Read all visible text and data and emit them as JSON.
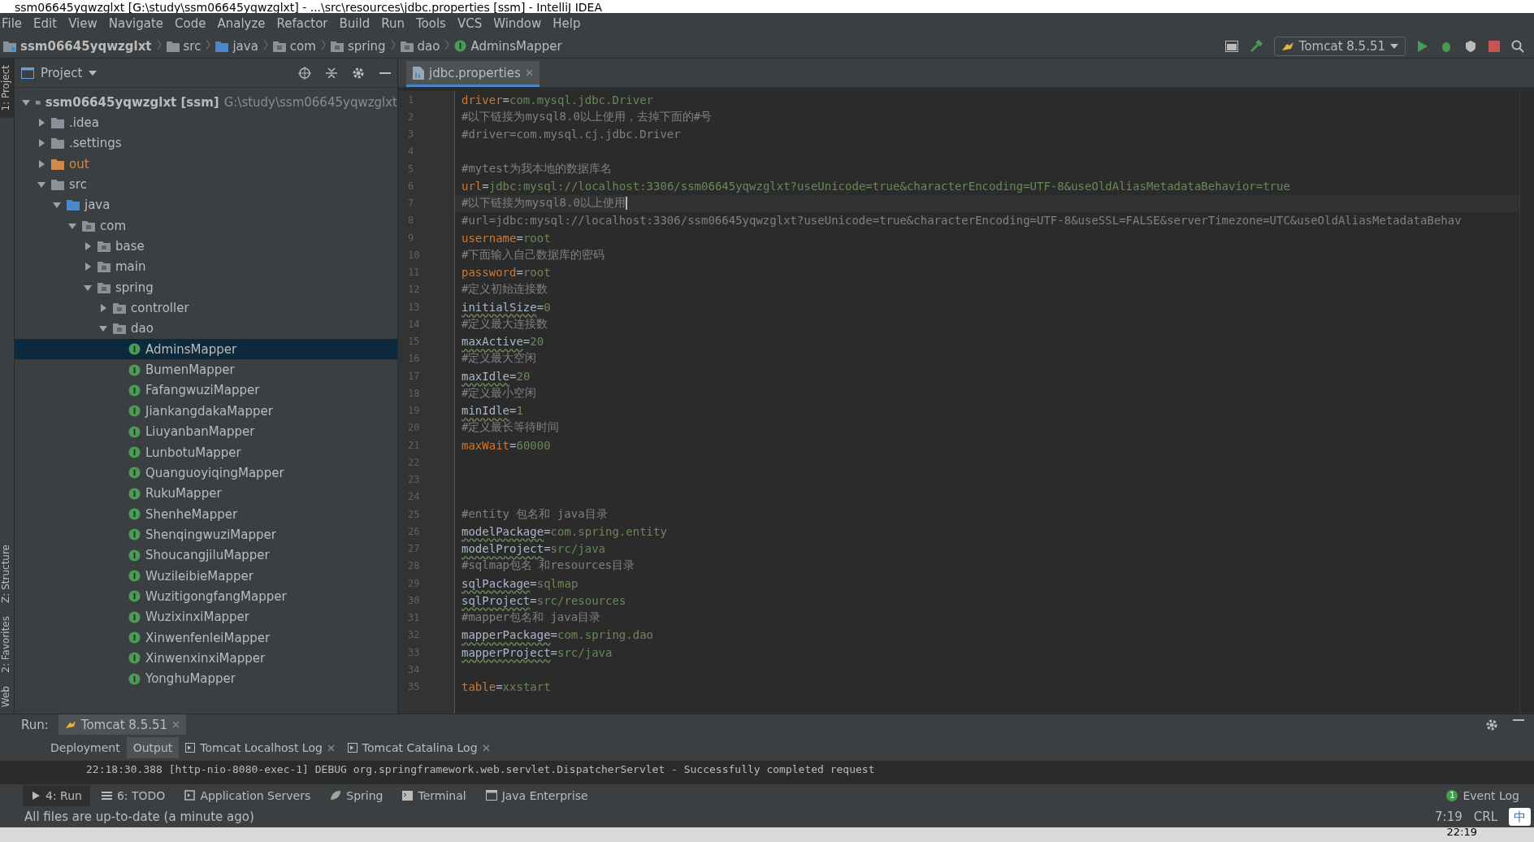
{
  "window": {
    "title": "ssm06645yqwzglxt [G:\\study\\ssm06645yqwzglxt] - ...\\src\\resources\\jdbc.properties [ssm] - IntelliJ IDEA"
  },
  "menu": [
    "File",
    "Edit",
    "View",
    "Navigate",
    "Code",
    "Analyze",
    "Refactor",
    "Build",
    "Run",
    "Tools",
    "VCS",
    "Window",
    "Help"
  ],
  "breadcrumbs": [
    {
      "label": "ssm06645yqwzglxt",
      "kind": "module"
    },
    {
      "label": "src",
      "kind": "folder"
    },
    {
      "label": "java",
      "kind": "source"
    },
    {
      "label": "com",
      "kind": "package"
    },
    {
      "label": "spring",
      "kind": "package"
    },
    {
      "label": "dao",
      "kind": "package"
    },
    {
      "label": "AdminsMapper",
      "kind": "interface"
    }
  ],
  "run_config": {
    "label": "Tomcat 8.5.51"
  },
  "side_tabs": [
    {
      "label": "1: Project",
      "selected": true
    },
    {
      "label": "Z: Structure",
      "selected": false
    },
    {
      "label": "2: Favorites",
      "selected": false
    },
    {
      "label": "Web",
      "selected": false
    }
  ],
  "project_panel": {
    "title": "Project",
    "tree": [
      {
        "label": "ssm06645yqwzglxt [ssm]",
        "path": "G:\\study\\ssm06645yqwzglxt",
        "kind": "module",
        "expanded": true,
        "selected": false,
        "children": [
          {
            "label": ".idea",
            "kind": "folder",
            "expanded": false,
            "selected": false
          },
          {
            "label": ".settings",
            "kind": "folder",
            "expanded": false,
            "selected": false
          },
          {
            "label": "out",
            "kind": "excluded",
            "expanded": false,
            "selected": false
          },
          {
            "label": "src",
            "kind": "folder",
            "expanded": true,
            "selected": false,
            "children": [
              {
                "label": "java",
                "kind": "source",
                "expanded": true,
                "selected": false,
                "children": [
                  {
                    "label": "com",
                    "kind": "package",
                    "expanded": true,
                    "selected": false,
                    "children": [
                      {
                        "label": "base",
                        "kind": "package",
                        "expanded": false,
                        "selected": false
                      },
                      {
                        "label": "main",
                        "kind": "package",
                        "expanded": false,
                        "selected": false
                      },
                      {
                        "label": "spring",
                        "kind": "package",
                        "expanded": true,
                        "selected": false,
                        "children": [
                          {
                            "label": "controller",
                            "kind": "package",
                            "expanded": false,
                            "selected": false
                          },
                          {
                            "label": "dao",
                            "kind": "package",
                            "expanded": true,
                            "selected": false,
                            "children": [
                              {
                                "label": "AdminsMapper",
                                "kind": "interface",
                                "selected": true
                              },
                              {
                                "label": "BumenMapper",
                                "kind": "interface",
                                "selected": false
                              },
                              {
                                "label": "FafangwuziMapper",
                                "kind": "interface",
                                "selected": false
                              },
                              {
                                "label": "JiankangdakaMapper",
                                "kind": "interface",
                                "selected": false
                              },
                              {
                                "label": "LiuyanbanMapper",
                                "kind": "interface",
                                "selected": false
                              },
                              {
                                "label": "LunbotuMapper",
                                "kind": "interface",
                                "selected": false
                              },
                              {
                                "label": "QuanguoyiqingMapper",
                                "kind": "interface",
                                "selected": false
                              },
                              {
                                "label": "RukuMapper",
                                "kind": "interface",
                                "selected": false
                              },
                              {
                                "label": "ShenheMapper",
                                "kind": "interface",
                                "selected": false
                              },
                              {
                                "label": "ShenqingwuziMapper",
                                "kind": "interface",
                                "selected": false
                              },
                              {
                                "label": "ShoucangjiluMapper",
                                "kind": "interface",
                                "selected": false
                              },
                              {
                                "label": "WuzileibieMapper",
                                "kind": "interface",
                                "selected": false
                              },
                              {
                                "label": "WuzitigongfangMapper",
                                "kind": "interface",
                                "selected": false
                              },
                              {
                                "label": "WuzixinxiMapper",
                                "kind": "interface",
                                "selected": false
                              },
                              {
                                "label": "XinwenfenleiMapper",
                                "kind": "interface",
                                "selected": false
                              },
                              {
                                "label": "XinwenxinxiMapper",
                                "kind": "interface",
                                "selected": false
                              },
                              {
                                "label": "YonghuMapper",
                                "kind": "interface",
                                "selected": false
                              }
                            ]
                          }
                        ]
                      }
                    ]
                  }
                ]
              }
            ]
          }
        ]
      }
    ]
  },
  "editor": {
    "tabs": [
      {
        "label": "jdbc.properties",
        "selected": true
      }
    ],
    "lines": [
      {
        "number": "1",
        "kind": "prop",
        "key": "driver",
        "separator": "=",
        "value": "com.mysql.jdbc.Driver",
        "unresolved": false,
        "current": false
      },
      {
        "number": "2",
        "kind": "comment",
        "text": "#以下链接为mysql8.0以上使用，去掉下面的#号",
        "current": false
      },
      {
        "number": "3",
        "kind": "comment",
        "text": "#driver=com.mysql.cj.jdbc.Driver",
        "current": false
      },
      {
        "number": "4",
        "kind": "blank",
        "current": false
      },
      {
        "number": "5",
        "kind": "comment",
        "text": "#mytest为我本地的数据库名",
        "current": false
      },
      {
        "number": "6",
        "kind": "prop",
        "key": "url",
        "separator": "=",
        "value": "jdbc:mysql://localhost:3306/ssm06645yqwzglxt?useUnicode=true&characterEncoding=UTF-8&useOldAliasMetadataBehavior=true",
        "unresolved": false,
        "current": false
      },
      {
        "number": "7",
        "kind": "comment",
        "text": "#以下链接为mysql8.0以上使用",
        "current": true
      },
      {
        "number": "8",
        "kind": "comment",
        "text": "#url=jdbc:mysql://localhost:3306/ssm06645yqwzglxt?useUnicode=true&characterEncoding=UTF-8&useSSL=FALSE&serverTimezone=UTC&useOldAliasMetadataBehav",
        "current": false
      },
      {
        "number": "9",
        "kind": "prop",
        "key": "username",
        "separator": "=",
        "value": "root",
        "unresolved": false,
        "current": false
      },
      {
        "number": "10",
        "kind": "comment",
        "text": "#下面输入自己数据库的密码",
        "current": false
      },
      {
        "number": "11",
        "kind": "prop",
        "key": "password",
        "separator": "=",
        "value": "root",
        "unresolved": false,
        "current": false
      },
      {
        "number": "12",
        "kind": "comment",
        "text": "#定义初始连接数",
        "current": false
      },
      {
        "number": "13",
        "kind": "prop",
        "key": "initialSize",
        "separator": "=",
        "value": "0",
        "unresolved": true,
        "current": false
      },
      {
        "number": "14",
        "kind": "comment",
        "text": "#定义最大连接数",
        "current": false
      },
      {
        "number": "15",
        "kind": "prop",
        "key": "maxActive",
        "separator": "=",
        "value": "20",
        "unresolved": true,
        "current": false
      },
      {
        "number": "16",
        "kind": "comment",
        "text": "#定义最大空闲",
        "current": false
      },
      {
        "number": "17",
        "kind": "prop",
        "key": "maxIdle",
        "separator": "=",
        "value": "20",
        "unresolved": true,
        "current": false
      },
      {
        "number": "18",
        "kind": "comment",
        "text": "#定义最小空闲",
        "current": false
      },
      {
        "number": "19",
        "kind": "prop",
        "key": "minIdle",
        "separator": "=",
        "value": "1",
        "unresolved": true,
        "current": false
      },
      {
        "number": "20",
        "kind": "comment",
        "text": "#定义最长等待时间",
        "current": false
      },
      {
        "number": "21",
        "kind": "prop",
        "key": "maxWait",
        "separator": "=",
        "value": "60000",
        "unresolved": false,
        "current": false
      },
      {
        "number": "22",
        "kind": "blank",
        "current": false
      },
      {
        "number": "23",
        "kind": "blank",
        "current": false
      },
      {
        "number": "24",
        "kind": "blank",
        "current": false
      },
      {
        "number": "25",
        "kind": "comment",
        "text": "#entity 包名和 java目录",
        "current": false
      },
      {
        "number": "26",
        "kind": "prop",
        "key": "modelPackage",
        "separator": "=",
        "value": "com.spring.entity",
        "unresolved": true,
        "current": false
      },
      {
        "number": "27",
        "kind": "prop",
        "key": "modelProject",
        "separator": "=",
        "value": "src/java",
        "unresolved": true,
        "current": false
      },
      {
        "number": "28",
        "kind": "comment",
        "text": "#sqlmap包名 和resources目录",
        "current": false
      },
      {
        "number": "29",
        "kind": "prop",
        "key": "sqlPackage",
        "separator": "=",
        "value": "sqlmap",
        "unresolved": true,
        "current": false
      },
      {
        "number": "30",
        "kind": "prop",
        "key": "sqlProject",
        "separator": "=",
        "value": "src/resources",
        "unresolved": true,
        "current": false
      },
      {
        "number": "31",
        "kind": "comment",
        "text": "#mapper包名和 java目录",
        "current": false
      },
      {
        "number": "32",
        "kind": "prop",
        "key": "mapperPackage",
        "separator": "=",
        "value": "com.spring.dao",
        "unresolved": true,
        "current": false
      },
      {
        "number": "33",
        "kind": "prop",
        "key": "mapperProject",
        "separator": "=",
        "value": "src/java",
        "unresolved": true,
        "current": false
      },
      {
        "number": "34",
        "kind": "blank",
        "current": false
      },
      {
        "number": "35",
        "kind": "prop",
        "key": "table",
        "separator": "=",
        "value": "xxstart",
        "unresolved": false,
        "current": false
      }
    ]
  },
  "run_panel": {
    "label": "Run:",
    "session": "Tomcat 8.5.51",
    "tabs": [
      {
        "label": "Deployment",
        "selected": false
      },
      {
        "label": "Output",
        "selected": true
      },
      {
        "label": "Tomcat Localhost Log",
        "selected": false
      },
      {
        "label": "Tomcat Catalina Log",
        "selected": false
      }
    ],
    "log": "22:18:30.388 [http-nio-8080-exec-1] DEBUG org.springframework.web.servlet.DispatcherServlet - Successfully completed request"
  },
  "tool_tabs": [
    {
      "label": "4: Run",
      "kind": "run",
      "selected": true
    },
    {
      "label": "6: TODO",
      "kind": "todo",
      "selected": false
    },
    {
      "label": "Application Servers",
      "kind": "servers",
      "selected": false
    },
    {
      "label": "Spring",
      "kind": "spring",
      "selected": false
    },
    {
      "label": "Terminal",
      "kind": "terminal",
      "selected": false
    },
    {
      "label": "Java Enterprise",
      "kind": "enterprise",
      "selected": false
    }
  ],
  "event_log": {
    "label": "Event Log",
    "count": "1"
  },
  "status_bar": {
    "message": "All files are up-to-date (a minute ago)",
    "position": "7:19",
    "line_sep": "CRL",
    "ime": "中"
  },
  "taskbar": {
    "time": "22:19"
  }
}
